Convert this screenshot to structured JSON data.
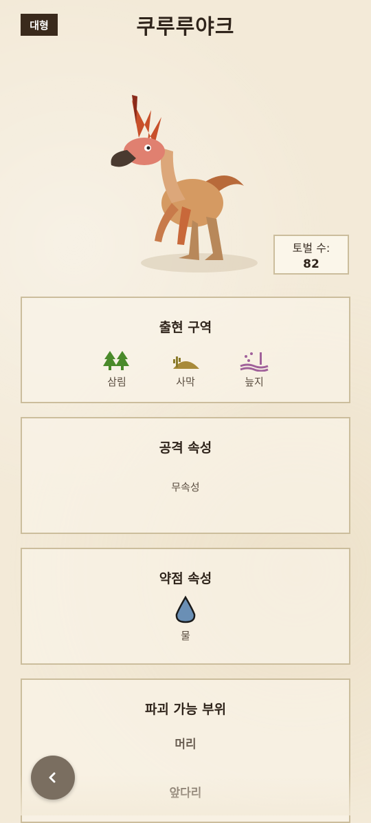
{
  "header": {
    "badge": "대형",
    "title": "쿠루루야크"
  },
  "hunt_count": {
    "label": "토벌 수:",
    "value": "82"
  },
  "habitat": {
    "title": "출현 구역",
    "items": [
      {
        "label": "삼림",
        "icon": "forest-icon",
        "color": "#4a8a2a"
      },
      {
        "label": "사막",
        "icon": "desert-icon",
        "color": "#a88a3a"
      },
      {
        "label": "늪지",
        "icon": "swamp-icon",
        "color": "#a0609a"
      }
    ]
  },
  "attack": {
    "title": "공격 속성",
    "value": "무속성"
  },
  "weakness": {
    "title": "약점 속성",
    "icon": "water-drop-icon",
    "color": "#6a8fb5",
    "value": "물"
  },
  "breakable": {
    "title": "파괴 가능 부위",
    "parts": [
      "머리",
      "앞다리"
    ]
  }
}
